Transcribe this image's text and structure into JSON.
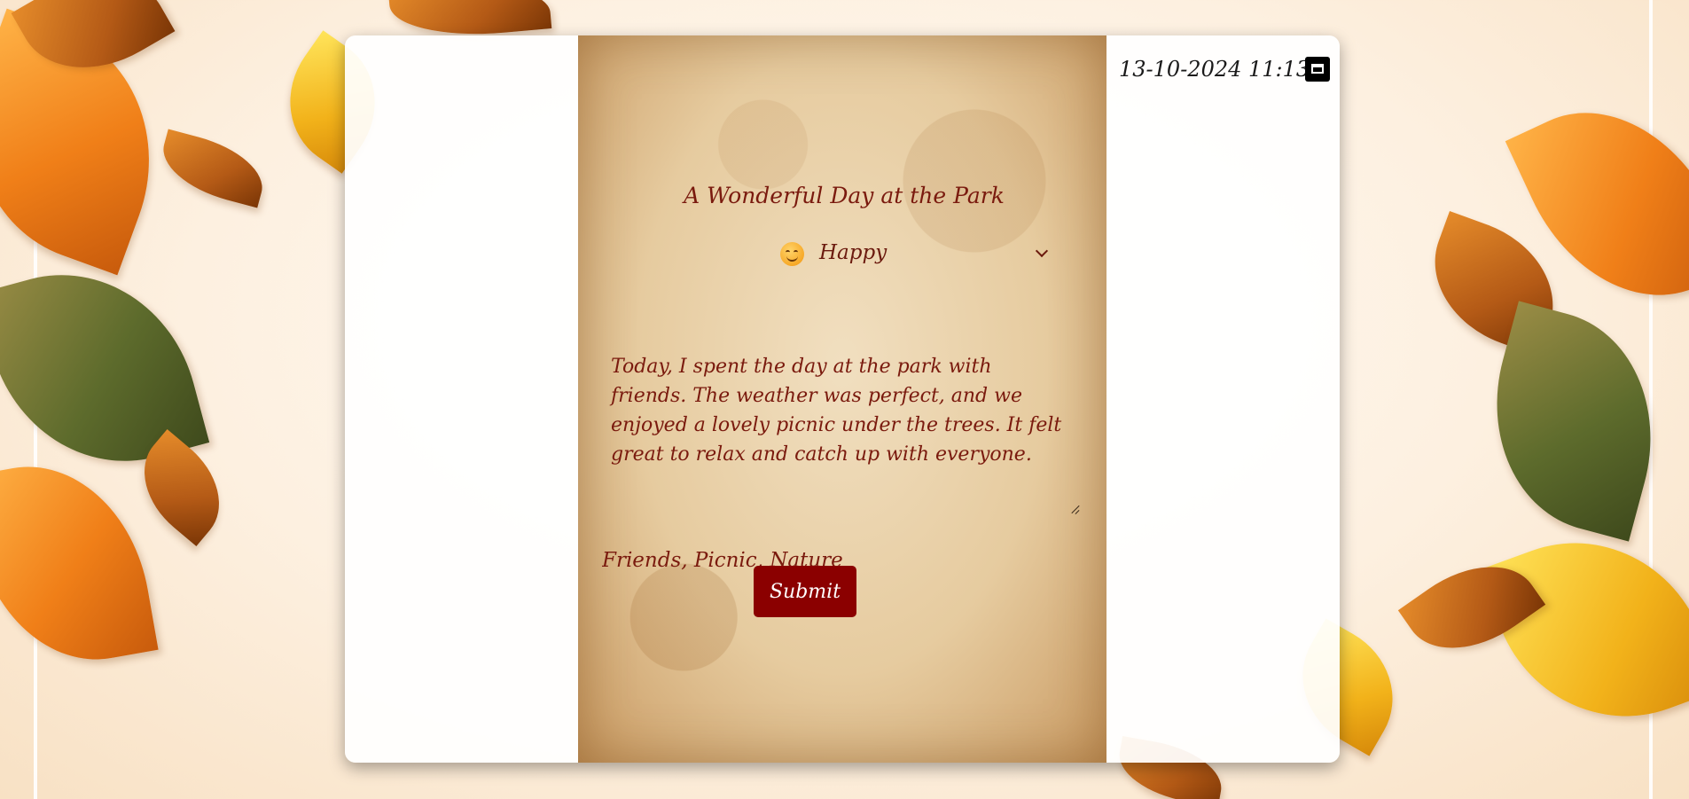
{
  "journal": {
    "title": "A Wonderful Day at the Park",
    "mood": {
      "emoji_icon": "smiling-face",
      "label": "Happy"
    },
    "entry": "Today, I spent the day at the park with friends. The weather was perfect, and we enjoyed a lovely picnic under the trees. It felt great to relax and catch up with everyone.",
    "tags": "Friends, Picnic, Nature",
    "submit_label": "Submit"
  },
  "datetime": {
    "value": "13-10-2024 11:13",
    "icon": "calendar-icon"
  },
  "colors": {
    "accent": "#8b0000",
    "ink": "#7a1a0e"
  }
}
